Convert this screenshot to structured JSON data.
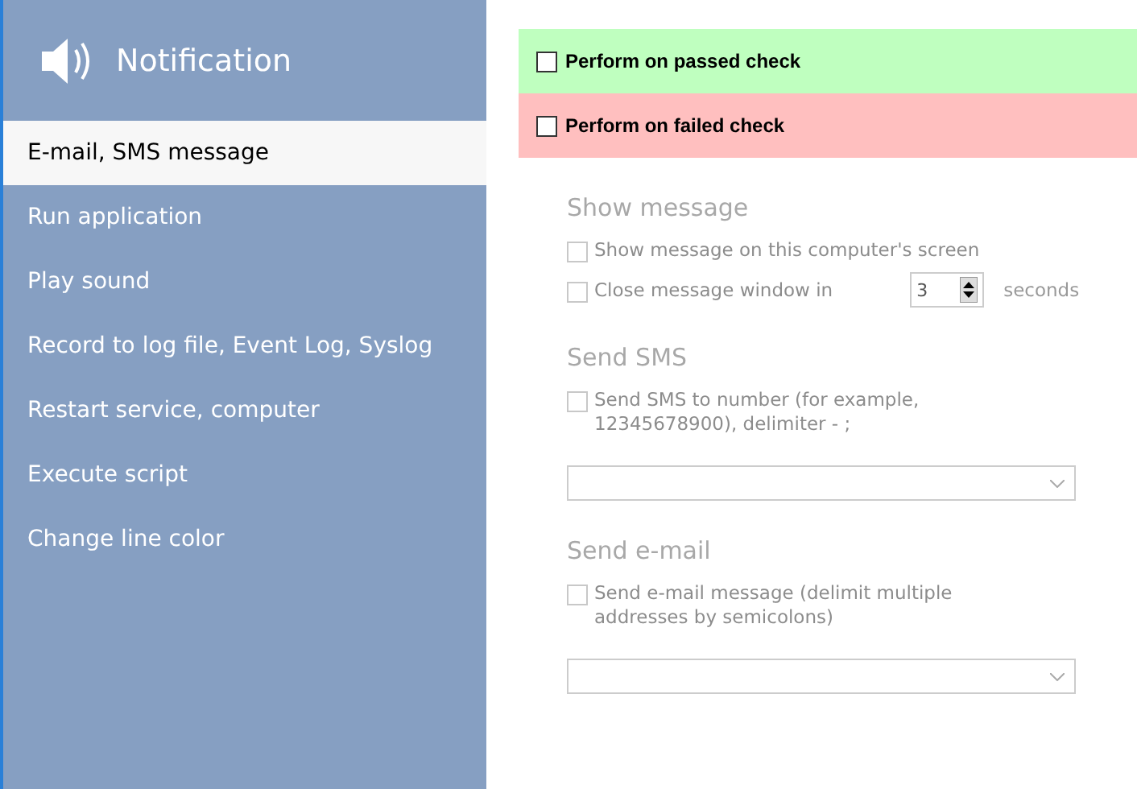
{
  "sidebar": {
    "title": "Notification",
    "items": [
      {
        "label": "E-mail, SMS message",
        "selected": true
      },
      {
        "label": "Run application",
        "selected": false
      },
      {
        "label": "Play sound",
        "selected": false
      },
      {
        "label": "Record to log file, Event Log, Syslog",
        "selected": false
      },
      {
        "label": "Restart service, computer",
        "selected": false
      },
      {
        "label": "Execute script",
        "selected": false
      },
      {
        "label": "Change line color",
        "selected": false
      }
    ]
  },
  "triggers": [
    {
      "label": "Perform on passed check",
      "checked": false,
      "color": "#bfffbf"
    },
    {
      "label": "Perform on failed check",
      "checked": false,
      "color": "#ffbfbf"
    }
  ],
  "sections": [
    {
      "heading": "Show message",
      "disabled": true,
      "options": [
        {
          "kind": "check",
          "label": "Show message on this computer's screen",
          "checked": false
        },
        {
          "kind": "timer",
          "label": "Close message window in",
          "checked": false,
          "value": "3",
          "unit": "seconds"
        }
      ]
    },
    {
      "heading": "Send SMS",
      "disabled": true,
      "options": [
        {
          "kind": "check",
          "label": "Send SMS to number (for example, 12345678900), delimiter - ;",
          "checked": false
        },
        {
          "kind": "dropdown"
        }
      ]
    },
    {
      "heading": "Send e-mail",
      "disabled": true,
      "options": [
        {
          "kind": "check",
          "label": "Send e-mail message (delimit multiple addresses by semicolons)",
          "checked": false
        },
        {
          "kind": "dropdown"
        }
      ]
    }
  ]
}
